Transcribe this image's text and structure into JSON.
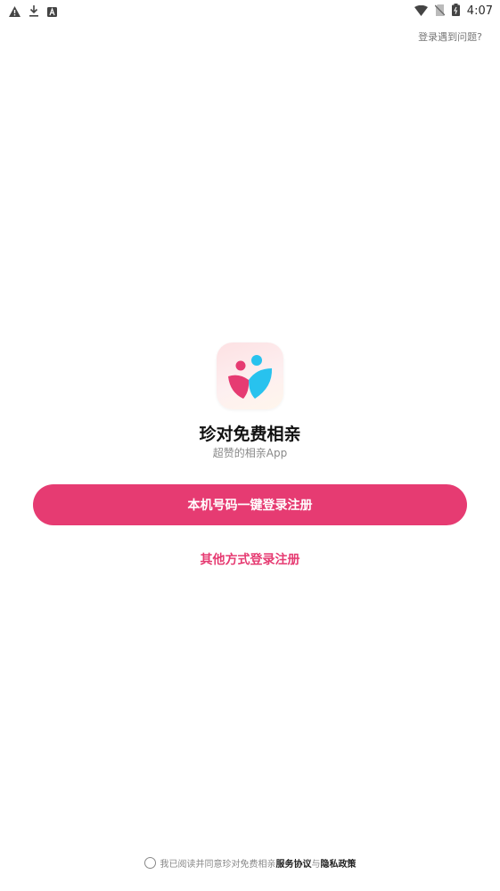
{
  "status_bar": {
    "time": "4:07",
    "left_icons": [
      "alert-icon",
      "download-icon",
      "app-a-icon"
    ],
    "right_icons": [
      "wifi-icon",
      "no-sim-icon",
      "battery-icon"
    ]
  },
  "header": {
    "help_link": "登录遇到问题?"
  },
  "app": {
    "name": "珍对免费相亲",
    "subtitle": "超赞的相亲App"
  },
  "actions": {
    "primary_login": "本机号码一键登录注册",
    "other_login": "其他方式登录注册"
  },
  "agreement": {
    "prefix": "我已阅读并同意珍对免费相亲",
    "service_link": "服务协议",
    "joiner": "与",
    "privacy_link": "隐私政策",
    "checked": false
  },
  "colors": {
    "accent": "#e63b72",
    "secondary": "#28c2ee",
    "background": "#ffffff"
  }
}
